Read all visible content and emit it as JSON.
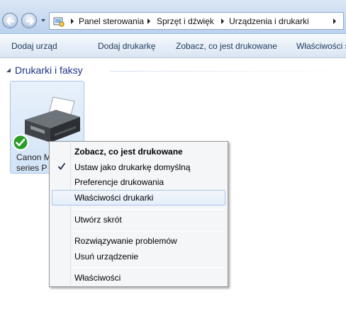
{
  "breadcrumb": {
    "items": [
      "Panel sterowania",
      "Sprzęt i dźwięk",
      "Urządzenia i drukarki"
    ]
  },
  "commands": [
    "Dodaj urząd",
    "Dodaj drukarkę",
    "Zobacz, co jest drukowane",
    "Właściwości s"
  ],
  "group": {
    "title": "Drukarki i faksy"
  },
  "device": {
    "line1": "Canon M",
    "line2": "series P",
    "status": "default"
  },
  "context_menu": {
    "items": [
      {
        "label": "Zobacz, co jest drukowane",
        "bold": true
      },
      {
        "label": "Ustaw jako drukarkę domyślną",
        "checked": true
      },
      {
        "label": "Preferencje drukowania"
      },
      {
        "label": "Właściwości drukarki",
        "highlighted": true
      },
      {
        "label": "Utwórz skrót"
      },
      {
        "label": "Rozwiązywanie problemów"
      },
      {
        "label": "Usuń urządzenie"
      },
      {
        "label": "Właściwości"
      }
    ]
  },
  "colors": {
    "accent": "#1e3287",
    "menu_highlight": "#a8c6ea",
    "default_badge": "#2a9d2a"
  }
}
